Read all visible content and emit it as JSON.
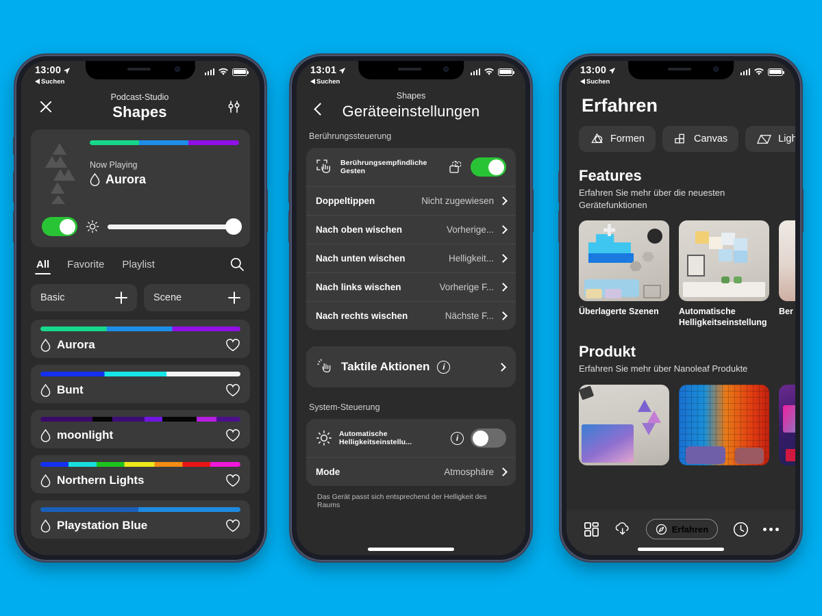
{
  "background_color": "#00ADEE",
  "phone1": {
    "status": {
      "time": "13:00",
      "back_label": "Suchen",
      "location_icon": "location-arrow-icon",
      "signal_icon": "cellular-signal-icon",
      "wifi_icon": "wifi-icon",
      "battery_icon": "battery-icon"
    },
    "header": {
      "close_icon": "close-icon",
      "subtitle": "Podcast-Studio",
      "title": "Shapes",
      "settings_icon": "sliders-icon"
    },
    "now_playing": {
      "device_icon": "nanoleaf-shapes-icon",
      "label": "Now Playing",
      "scene_icon": "droplet-icon",
      "scene_name": "Aurora",
      "power_toggle": "on",
      "brightness_icon": "brightness-icon",
      "brightness_percent": 100,
      "gradient": [
        "#1fd77f",
        "#1fd77f",
        "#1a8fe8",
        "#1a8fe8",
        "#9313e8",
        "#9313e8"
      ]
    },
    "tabs": [
      {
        "label": "All",
        "active": true
      },
      {
        "label": "Favorite",
        "active": false
      },
      {
        "label": "Playlist",
        "active": false
      }
    ],
    "search_icon": "search-icon",
    "quick_actions": [
      {
        "label": "Basic",
        "icon": "plus-icon"
      },
      {
        "label": "Scene",
        "icon": "plus-icon"
      }
    ],
    "scenes": [
      {
        "name": "Aurora",
        "icon": "droplet-icon",
        "favorite_icon": "heart-outline-icon",
        "stops": [
          "#17d88a 0%",
          "#17d88a 33%",
          "#1d8ee8 33%",
          "#1d8ee8 66%",
          "#9010e6 66%",
          "#9010e6 100%"
        ]
      },
      {
        "name": "Bunt",
        "icon": "droplet-icon",
        "favorite_icon": "heart-outline-icon",
        "stops": [
          "#1531f0 0%",
          "#1531f0 32%",
          "#16e6e6 32%",
          "#16e6e6 63%",
          "#f4f4f4 63%",
          "#f4f4f4 100%"
        ]
      },
      {
        "name": "moonlight",
        "icon": "droplet-icon",
        "favorite_icon": "heart-outline-icon",
        "stops": [
          "#3a0a6b 0%",
          "#3a0a6b 26%",
          "#050505 26%",
          "#050505 36%",
          "#3d0c77 36%",
          "#3d0c77 52%",
          "#7016e0 52%",
          "#7016e0 61%",
          "#050505 61%",
          "#050505 78%",
          "#b41fe0 78%",
          "#b41fe0 88%",
          "#4b0f8c 88%",
          "#4b0f8c 100%"
        ]
      },
      {
        "name": "Northern Lights",
        "icon": "droplet-icon",
        "favorite_icon": "heart-outline-icon",
        "stops": [
          "#1531f0 0%",
          "#1531f0 14%",
          "#19dede 14%",
          "#19dede 28%",
          "#1ec41e 28%",
          "#1ec41e 42%",
          "#ece81b 42%",
          "#ece81b 57%",
          "#f28c14 57%",
          "#f28c14 71%",
          "#ea1414 71%",
          "#ea1414 85%",
          "#f018d8 85%",
          "#f018d8 100%"
        ]
      },
      {
        "name": "Playstation Blue",
        "icon": "droplet-icon",
        "favorite_icon": "heart-outline-icon",
        "stops": [
          "#1a5fb8 0%",
          "#1a5fb8 49%",
          "#1f8ae0 49%",
          "#1f8ae0 100%"
        ]
      }
    ]
  },
  "phone2": {
    "status": {
      "time": "13:01",
      "back_label": "Suchen"
    },
    "header": {
      "back_icon": "chevron-left-icon",
      "subtitle": "Shapes",
      "title": "Geräteeinstellungen"
    },
    "section_touch_label": "Berührungssteuerung",
    "gesture_header": {
      "icon": "touch-gesture-icon",
      "label": "Berührungsempfindliche Gesten",
      "lock_icon": "unlock-icon",
      "toggle": "on"
    },
    "gestures": [
      {
        "key": "Doppeltippen",
        "value": "Nicht zugewiesen",
        "chevron": "chevron-right-icon"
      },
      {
        "key": "Nach oben wischen",
        "value": "Vorherige...",
        "chevron": "chevron-right-icon"
      },
      {
        "key": "Nach unten wischen",
        "value": "Helligkeit...",
        "chevron": "chevron-right-icon"
      },
      {
        "key": "Nach links wischen",
        "value": "Vorherige F...",
        "chevron": "chevron-right-icon"
      },
      {
        "key": "Nach rechts wischen",
        "value": "Nächste F...",
        "chevron": "chevron-right-icon"
      }
    ],
    "tactile": {
      "icon": "tap-hand-icon",
      "label": "Taktile Aktionen",
      "info_icon": "info-icon",
      "chevron": "chevron-right-icon"
    },
    "section_system_label": "System-Steuerung",
    "auto_brightness": {
      "icon": "brightness-icon",
      "label": "Automatische Helligkeitseinstellu...",
      "info_icon": "info-icon",
      "toggle": "off"
    },
    "mode": {
      "key": "Mode",
      "value": "Atmosphäre",
      "chevron": "chevron-right-icon"
    },
    "footnote": "Das Gerät passt sich entsprechend der Helligkeit des Raums"
  },
  "phone3": {
    "status": {
      "time": "13:00",
      "back_label": "Suchen"
    },
    "title": "Erfahren",
    "chips": [
      {
        "label": "Formen",
        "icon": "shapes-triangle-icon"
      },
      {
        "label": "Canvas",
        "icon": "canvas-squares-icon"
      },
      {
        "label": "Light P",
        "icon": "light-panels-icon"
      }
    ],
    "features": {
      "heading": "Features",
      "subtitle": "Erfahren Sie mehr über die neuesten Gerätefunktionen",
      "cards": [
        {
          "caption": "Überlagerte Szenen"
        },
        {
          "caption": "Automatische Helligkeitseinstellung"
        },
        {
          "caption": "Ber dlic"
        }
      ]
    },
    "product": {
      "heading": "Produkt",
      "subtitle": "Erfahren Sie mehr über Nanoleaf Produkte",
      "cards": [
        {
          "caption": ""
        },
        {
          "caption": ""
        },
        {
          "caption": ""
        }
      ]
    },
    "tabbar": [
      {
        "label": "",
        "icon": "dashboard-grid-icon",
        "active": false
      },
      {
        "label": "",
        "icon": "cloud-download-icon",
        "active": false
      },
      {
        "label": "Erfahren",
        "icon": "compass-icon",
        "active": true
      },
      {
        "label": "",
        "icon": "clock-icon",
        "active": false
      },
      {
        "label": "",
        "icon": "more-dots-icon",
        "active": false
      }
    ]
  }
}
